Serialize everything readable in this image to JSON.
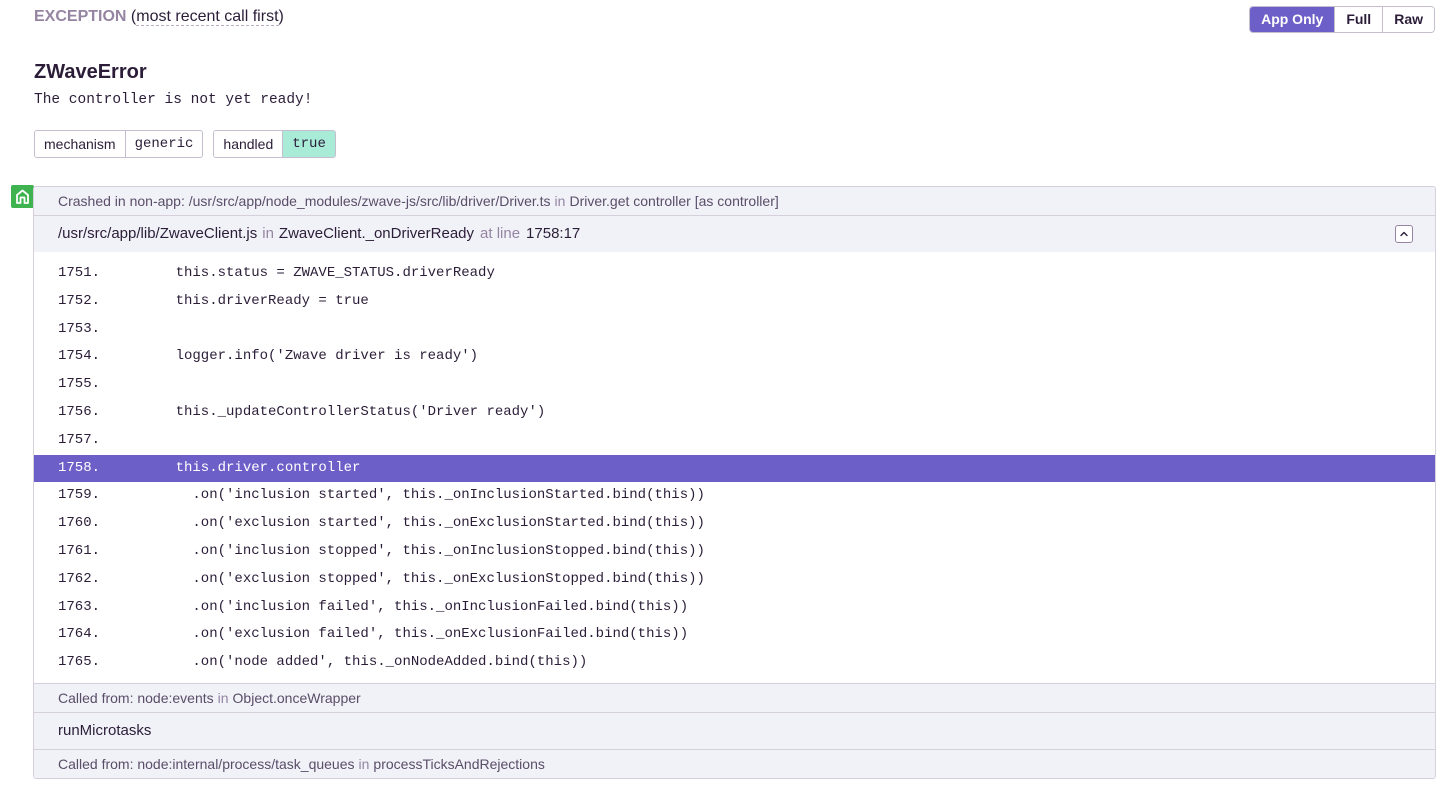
{
  "header": {
    "exception_label": "EXCEPTION",
    "subtitle_prefix": "(",
    "subtitle_link": "most recent call first",
    "subtitle_suffix": ")"
  },
  "view_toggle": {
    "options": [
      {
        "label": "App Only",
        "active": true
      },
      {
        "label": "Full",
        "active": false
      },
      {
        "label": "Raw",
        "active": false
      }
    ]
  },
  "error": {
    "type": "ZWaveError",
    "value": "The controller is not yet ready!"
  },
  "tags": [
    {
      "key": "mechanism",
      "value": "generic",
      "highlight": false
    },
    {
      "key": "handled",
      "value": "true",
      "highlight": true
    }
  ],
  "frames": {
    "crashed_row": {
      "prefix": "Crashed in non-app: /usr/src/app/node_modules/zwave-js/src/lib/driver/Driver.ts",
      "in": "in",
      "function": "Driver.get controller [as controller]"
    },
    "main_frame": {
      "file": "/usr/src/app/lib/ZwaveClient.js",
      "in": "in",
      "function": "ZwaveClient._onDriverReady",
      "at_line": "at line",
      "line_col": "1758:17"
    },
    "code_lines": [
      {
        "ln": "1751.",
        "code": "    this.status = ZWAVE_STATUS.driverReady",
        "active": false
      },
      {
        "ln": "1752.",
        "code": "    this.driverReady = true",
        "active": false
      },
      {
        "ln": "1753.",
        "code": "",
        "active": false
      },
      {
        "ln": "1754.",
        "code": "    logger.info('Zwave driver is ready')",
        "active": false
      },
      {
        "ln": "1755.",
        "code": "",
        "active": false
      },
      {
        "ln": "1756.",
        "code": "    this._updateControllerStatus('Driver ready')",
        "active": false
      },
      {
        "ln": "1757.",
        "code": "",
        "active": false
      },
      {
        "ln": "1758.",
        "code": "    this.driver.controller",
        "active": true
      },
      {
        "ln": "1759.",
        "code": "      .on('inclusion started', this._onInclusionStarted.bind(this))",
        "active": false
      },
      {
        "ln": "1760.",
        "code": "      .on('exclusion started', this._onExclusionStarted.bind(this))",
        "active": false
      },
      {
        "ln": "1761.",
        "code": "      .on('inclusion stopped', this._onInclusionStopped.bind(this))",
        "active": false
      },
      {
        "ln": "1762.",
        "code": "      .on('exclusion stopped', this._onExclusionStopped.bind(this))",
        "active": false
      },
      {
        "ln": "1763.",
        "code": "      .on('inclusion failed', this._onInclusionFailed.bind(this))",
        "active": false
      },
      {
        "ln": "1764.",
        "code": "      .on('exclusion failed', this._onExclusionFailed.bind(this))",
        "active": false
      },
      {
        "ln": "1765.",
        "code": "      .on('node added', this._onNodeAdded.bind(this))",
        "active": false
      }
    ],
    "called_from_1": {
      "prefix": "Called from: node:events",
      "in": "in",
      "function": "Object.onceWrapper"
    },
    "plain_frame": {
      "label": "runMicrotasks"
    },
    "called_from_2": {
      "prefix": "Called from: node:internal/process/task_queues",
      "in": "in",
      "function": "processTicksAndRejections"
    }
  },
  "colors": {
    "accent": "#6c5fc7",
    "in_app_icon": "#3fb34f",
    "handled_true": "#a8ecd8"
  }
}
